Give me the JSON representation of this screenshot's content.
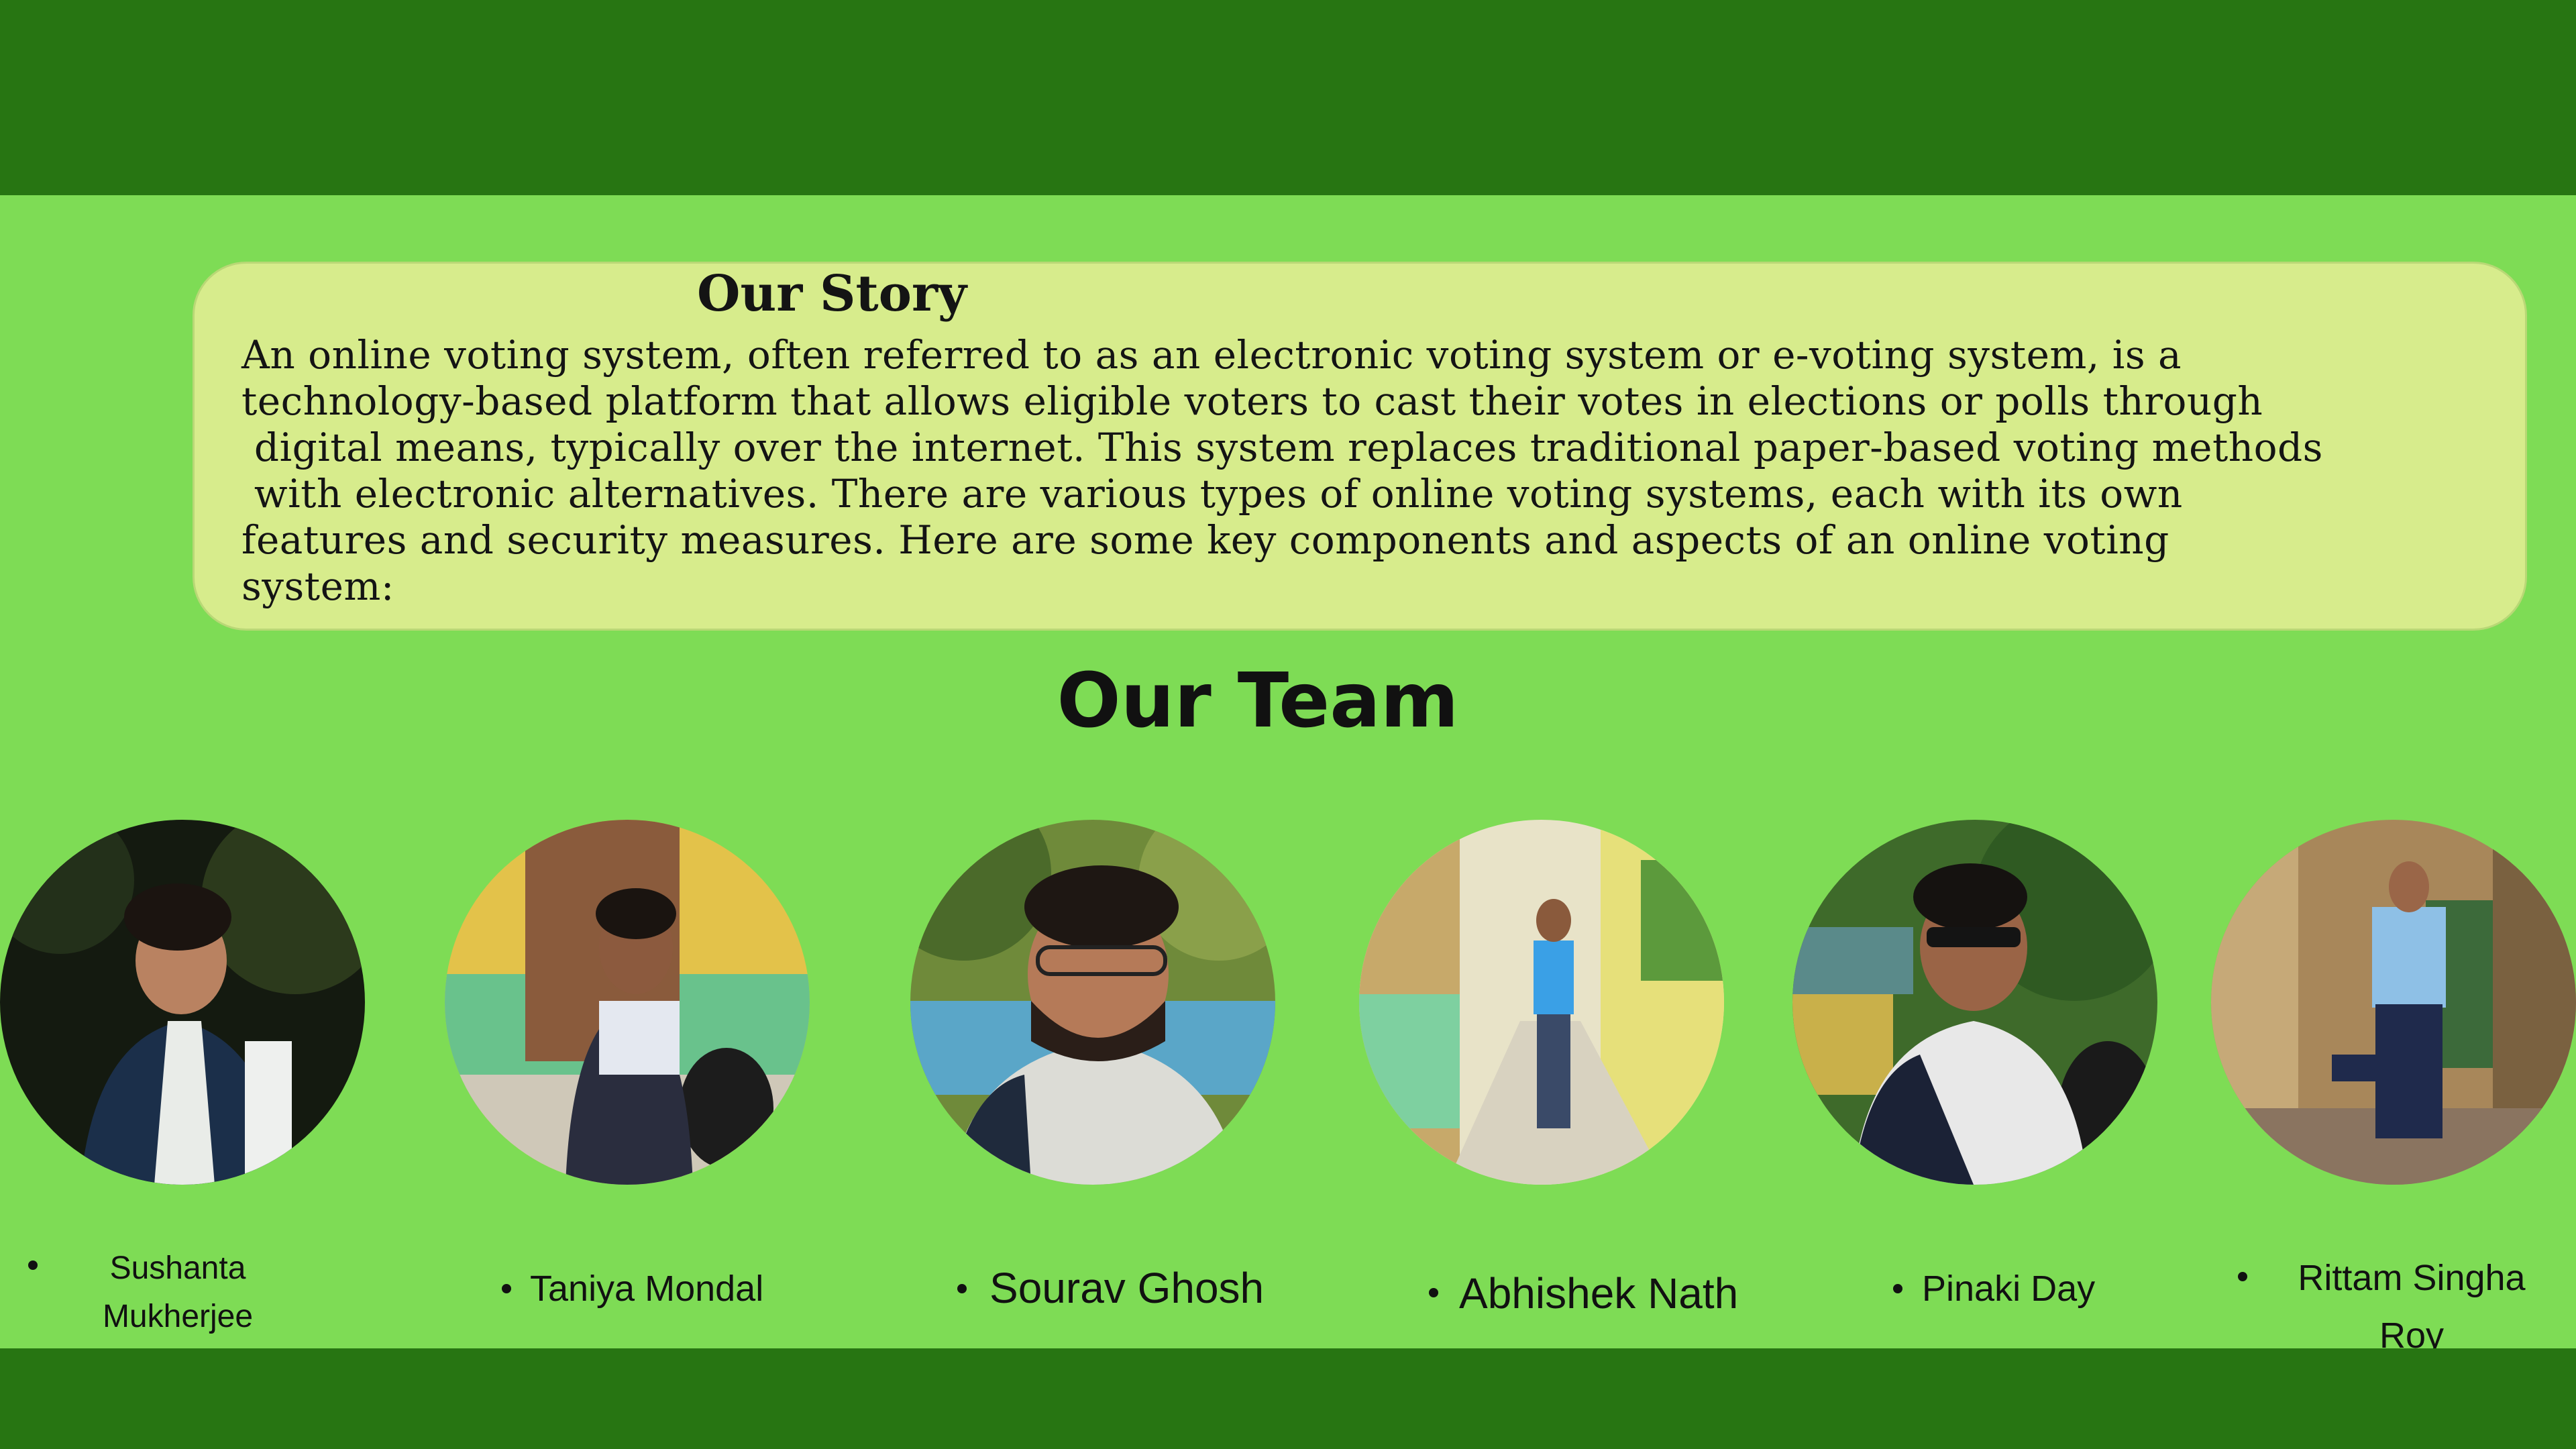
{
  "story": {
    "title": "Our Story",
    "body": "An online voting system, often referred to as an electronic voting system or e-voting system, is a\ntechnology-based platform that allows eligible voters to cast their votes in elections or polls through\n digital means, typically over the internet. This system replaces traditional paper-based voting methods\n with electronic alternatives. There are various types of online voting systems, each with its own\nfeatures and security measures. Here are some key components and aspects of an online voting\nsystem:"
  },
  "team": {
    "heading": "Our Team",
    "members": [
      {
        "name": "Sushanta Mukherjee",
        "line1": "Sushanta",
        "line2": "Mukherjee",
        "photo": "photo-person-outdoors-night"
      },
      {
        "name": "Taniya Mondal",
        "line1": "Taniya Mondal",
        "photo": "photo-person-sitting-steps"
      },
      {
        "name": "Sourav Ghosh",
        "line1": "Sourav Ghosh",
        "photo": "photo-person-glasses-closeup"
      },
      {
        "name": "Abhishek Nath",
        "line1": "Abhishek Nath",
        "photo": "photo-person-corridor"
      },
      {
        "name": "Pinaki Day",
        "line1": "Pinaki Day",
        "photo": "photo-person-sunglasses"
      },
      {
        "name": "Rittam Singha Roy",
        "line1": "Rittam Singha",
        "line2": "Roy",
        "photo": "photo-person-standing-ruins"
      }
    ]
  },
  "colors": {
    "background": "#7edc55",
    "bars": "#277512",
    "card": "#d7ec8c"
  }
}
